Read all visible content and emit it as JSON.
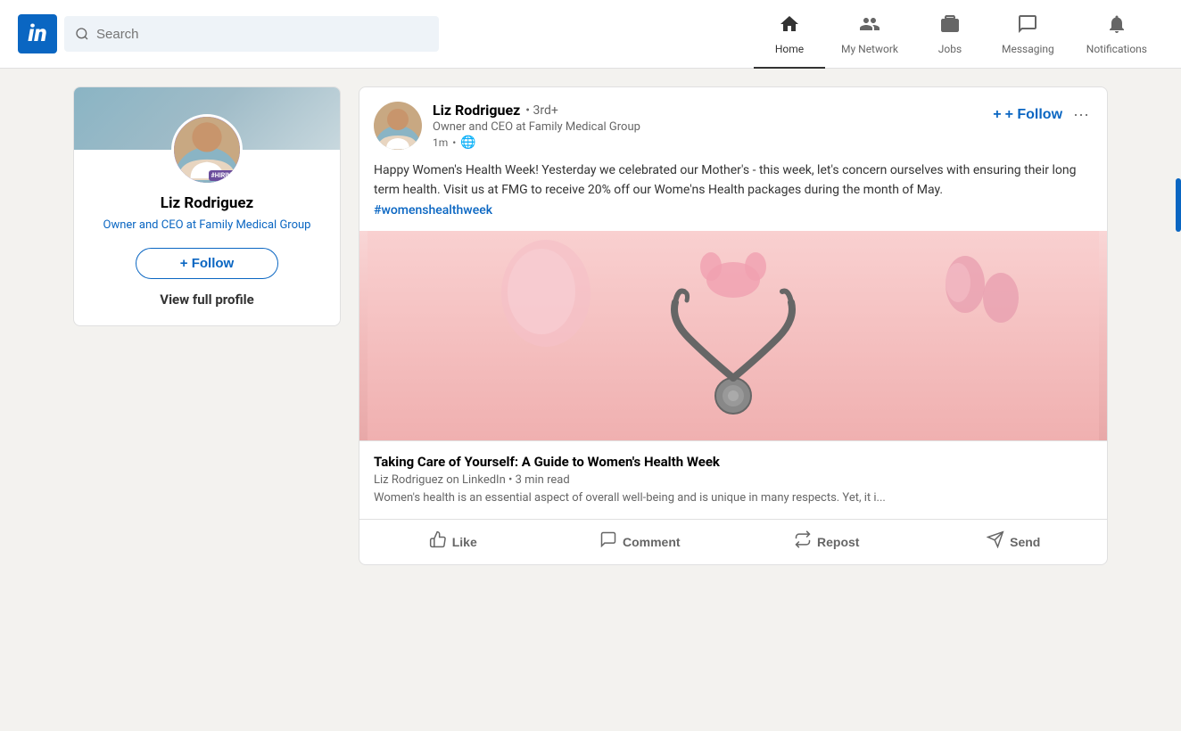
{
  "app": {
    "logo_text": "in",
    "brand_color": "#0a66c2"
  },
  "navbar": {
    "search_placeholder": "Search",
    "nav_items": [
      {
        "id": "home",
        "label": "Home",
        "icon": "🏠",
        "active": true
      },
      {
        "id": "network",
        "label": "My Network",
        "icon": "👥",
        "active": false
      },
      {
        "id": "jobs",
        "label": "Jobs",
        "icon": "💼",
        "active": false
      },
      {
        "id": "messaging",
        "label": "Messaging",
        "icon": "💬",
        "active": false
      },
      {
        "id": "notifications",
        "label": "Notifications",
        "icon": "🔔",
        "active": false
      }
    ]
  },
  "sidebar": {
    "user": {
      "name": "Liz Rodriguez",
      "title": "Owner and CEO at Family Medical Group",
      "hiring_badge": "#HIRING"
    },
    "follow_label": "+ Follow",
    "view_profile_label": "View full profile"
  },
  "post": {
    "author": {
      "name": "Liz Rodriguez",
      "degree": "• 3rd+",
      "title": "Owner and CEO at Family Medical Group",
      "time": "1m",
      "visibility": "🌐"
    },
    "follow_label": "+ Follow",
    "more_label": "···",
    "body_text": "Happy Women's Health Week! Yesterday we celebrated our Mother's - this week, let's concern ourselves with ensuring their long term health. Visit us at FMG to receive 20% off our Wome'ns Health packages during the month of May.",
    "hashtag": "#womenshealthweek",
    "article": {
      "title": "Taking Care of Yourself: A Guide to Women's Health Week",
      "source": "Liz Rodriguez on LinkedIn • 3 min read",
      "excerpt": "Women's health is an essential aspect of overall well-being and is unique in many respects. Yet, it i..."
    },
    "footer": {
      "like_label": "Like",
      "comment_label": "Comment",
      "repost_label": "Repost",
      "send_label": "Send"
    }
  }
}
